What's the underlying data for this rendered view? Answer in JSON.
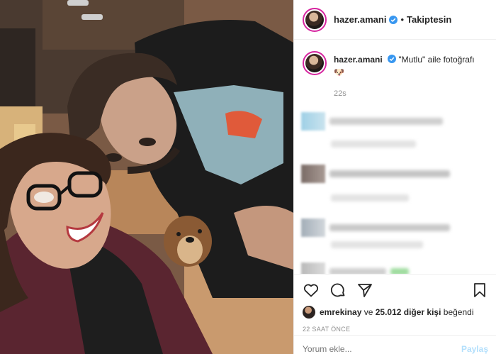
{
  "post": {
    "username": "hazer.amani",
    "follow_status": "Takiptesin",
    "caption_text": "\"Mutlu\" aile fotoğrafı",
    "caption_emoji": "🐶",
    "caption_time": "22s"
  },
  "likes": {
    "liker": "emrekinay",
    "middle": " ve ",
    "others": "25.012 diğer kişi",
    "suffix": " beğendi"
  },
  "posted_ago": "22 SAAT ÖNCE",
  "comment_input": {
    "placeholder": "Yorum ekle...",
    "post_label": "Paylaş"
  },
  "icons": [
    "heart-icon",
    "comment-icon",
    "share-icon",
    "bookmark-icon",
    "verified-badge-icon"
  ],
  "colors": {
    "verified": "#3897f0",
    "story_ring": "#d6249f",
    "post_button": "#b2dffc"
  }
}
